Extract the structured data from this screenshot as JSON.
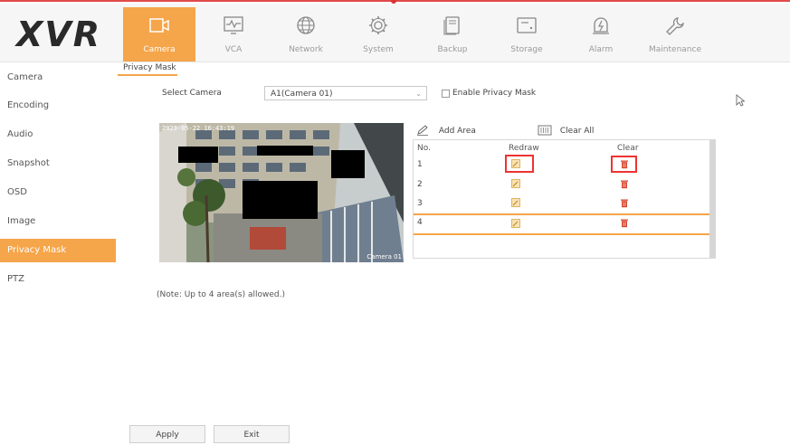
{
  "app": {
    "logo": "XVR"
  },
  "nav": {
    "items": [
      {
        "label": "Camera",
        "icon": "camera-icon",
        "active": true
      },
      {
        "label": "VCA",
        "icon": "vca-icon",
        "active": false
      },
      {
        "label": "Network",
        "icon": "globe-icon",
        "active": false
      },
      {
        "label": "System",
        "icon": "gear-icon",
        "active": false
      },
      {
        "label": "Backup",
        "icon": "backup-icon",
        "active": false
      },
      {
        "label": "Storage",
        "icon": "storage-icon",
        "active": false
      },
      {
        "label": "Alarm",
        "icon": "alarm-icon",
        "active": false
      },
      {
        "label": "Maintenance",
        "icon": "wrench-icon",
        "active": false
      }
    ]
  },
  "sidebar": {
    "items": [
      {
        "label": "Camera"
      },
      {
        "label": "Encoding"
      },
      {
        "label": "Audio"
      },
      {
        "label": "Snapshot"
      },
      {
        "label": "OSD"
      },
      {
        "label": "Image"
      },
      {
        "label": "Privacy Mask",
        "active": true
      },
      {
        "label": "PTZ"
      }
    ]
  },
  "page": {
    "subtab": "Privacy Mask",
    "select_camera_label": "Select Camera",
    "select_camera_value": "A1(Camera 01)",
    "enable_label": "Enable Privacy Mask",
    "preview_timestamp": "2023-05-22 16:43:19",
    "preview_camera_label": "Camera 01",
    "add_area": "Add Area",
    "clear_all": "Clear All",
    "table": {
      "headers": {
        "no": "No.",
        "redraw": "Redraw",
        "clear": "Clear"
      },
      "rows": [
        {
          "no": "1"
        },
        {
          "no": "2"
        },
        {
          "no": "3"
        },
        {
          "no": "4"
        }
      ]
    },
    "note": "(Note: Up to 4 area(s) allowed.)",
    "apply": "Apply",
    "exit": "Exit"
  },
  "colors": {
    "accent": "#f5a54a",
    "highlight": "#e33333",
    "mask": "#000000"
  }
}
